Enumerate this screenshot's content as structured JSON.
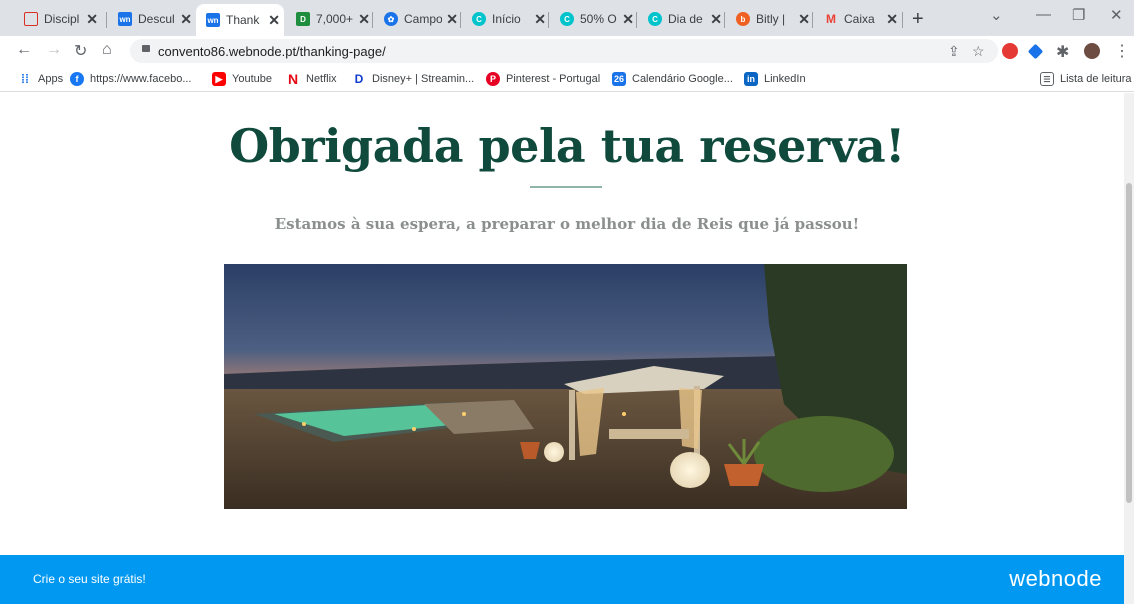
{
  "browser": {
    "tabs": [
      {
        "label": "Discipl",
        "icon": "square-outline-icon",
        "color": "#d93025"
      },
      {
        "label": "Descul",
        "icon": "webnode-icon",
        "color": "#1a73e8"
      },
      {
        "label": "Thank",
        "icon": "webnode-icon",
        "color": "#1a73e8"
      },
      {
        "label": "7,000+",
        "icon": "green-square-icon",
        "color": "#1e8e3e"
      },
      {
        "label": "Campo",
        "icon": "blue-flower-icon",
        "color": "#1a73e8"
      },
      {
        "label": "Início",
        "icon": "canva-icon",
        "color": "#00c4cc"
      },
      {
        "label": "50% O",
        "icon": "canva-icon",
        "color": "#00c4cc"
      },
      {
        "label": "Dia de",
        "icon": "canva-icon",
        "color": "#00c4cc"
      },
      {
        "label": "Bitly | ",
        "icon": "bitly-icon",
        "color": "#ee6123"
      },
      {
        "label": "Caixa",
        "icon": "gmail-icon",
        "color": "#ea4335"
      }
    ],
    "address": "convento86.webnode.pt/thanking-page/",
    "bookmarks": [
      {
        "label": "Apps",
        "icon": "apps-grid-icon",
        "color": "#1a73e8"
      },
      {
        "label": "https://www.facebo...",
        "icon": "facebook-icon",
        "color": "#1877f2"
      },
      {
        "label": "Youtube",
        "icon": "youtube-icon",
        "color": "#ff0000"
      },
      {
        "label": "Netflix",
        "icon": "netflix-icon",
        "color": "#e50914"
      },
      {
        "label": "Disney+ | Streamin...",
        "icon": "disney-icon",
        "color": "#113ccf"
      },
      {
        "label": "Pinterest - Portugal",
        "icon": "pinterest-icon",
        "color": "#e60023"
      },
      {
        "label": "Calendário Google...",
        "icon": "calendar-icon",
        "color": "#1a73e8"
      },
      {
        "label": "LinkedIn",
        "icon": "linkedin-icon",
        "color": "#0a66c2"
      }
    ],
    "reading_list": "Lista de leitura"
  },
  "page": {
    "headline": "Obrigada pela tua reserva!",
    "subtitle": "Estamos à sua espera, a preparar o melhor dia de Reis que já passou!",
    "colors": {
      "headline": "#104a3c",
      "footer": "#0198f1"
    }
  },
  "footer": {
    "cta": "Crie o seu site grátis!",
    "brand": "webnode"
  }
}
